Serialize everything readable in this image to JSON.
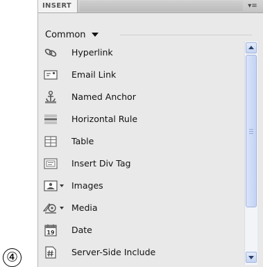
{
  "step_marker": "④",
  "panel": {
    "tab_label": "INSERT",
    "options_glyph": "▾≡",
    "category": "Common"
  },
  "items": [
    {
      "label": "Hyperlink",
      "icon": "hyperlink-icon",
      "has_dropdown": false
    },
    {
      "label": "Email Link",
      "icon": "email-link-icon",
      "has_dropdown": false
    },
    {
      "label": "Named Anchor",
      "icon": "named-anchor-icon",
      "has_dropdown": false
    },
    {
      "label": "Horizontal Rule",
      "icon": "horizontal-rule-icon",
      "has_dropdown": false
    },
    {
      "label": "Table",
      "icon": "table-icon",
      "has_dropdown": false
    },
    {
      "label": "Insert Div Tag",
      "icon": "div-tag-icon",
      "has_dropdown": false
    },
    {
      "label": "Images",
      "icon": "images-icon",
      "has_dropdown": true
    },
    {
      "label": "Media",
      "icon": "media-icon",
      "has_dropdown": true
    },
    {
      "label": "Date",
      "icon": "date-icon",
      "has_dropdown": false
    },
    {
      "label": "Server-Side Include",
      "icon": "server-side-include-icon",
      "has_dropdown": false
    }
  ],
  "date_icon_text": "19"
}
